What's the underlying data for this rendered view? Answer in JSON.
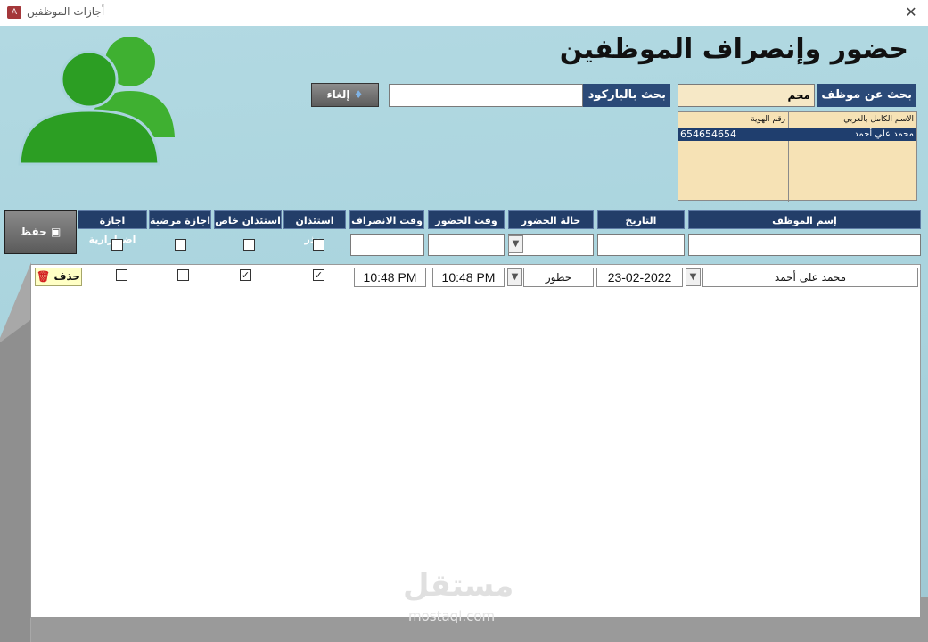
{
  "window": {
    "title": "أجازات الموظفين",
    "app_icon": "A"
  },
  "header": {
    "title": "حضور وإنصراف  الموظفين"
  },
  "search": {
    "label": "بحث عن موظف :",
    "value": "محم"
  },
  "barcode": {
    "label": "بحث بالباركود",
    "value": ""
  },
  "cancel_button": {
    "label": "إلغاء"
  },
  "results_list": {
    "columns": [
      "الاسم الكامل بالعربي",
      "رقم الهوية"
    ],
    "rows": [
      {
        "name": "محمد علي أحمد",
        "id": "654654654"
      }
    ]
  },
  "columns": [
    "إسم الموظف",
    "التاريخ",
    "حالة الحضور",
    "وقت الحضور",
    "وقت الانصراف",
    "استئذان بعذر",
    "استئذان خاص",
    "اجازة مرضية",
    "اجازة اضطرارية"
  ],
  "save_button": {
    "label": "حفظ"
  },
  "record": {
    "employee": "محمد على أحمد",
    "date": "23-02-2022",
    "status": "حظور",
    "check_in": "10:48 PM",
    "check_out": "10:48 PM",
    "excused_leave": true,
    "private_leave": true,
    "sick_leave": false,
    "emergency_leave": false
  },
  "delete_button": {
    "label": "حذف"
  },
  "watermark": {
    "text": "مستقل",
    "sub": "mostaql.com"
  },
  "colors": {
    "header_blue": "#233e69",
    "background_blue": "#a8d3dd",
    "people_green": "#3aaa2d",
    "beige": "#f6e8c6"
  }
}
